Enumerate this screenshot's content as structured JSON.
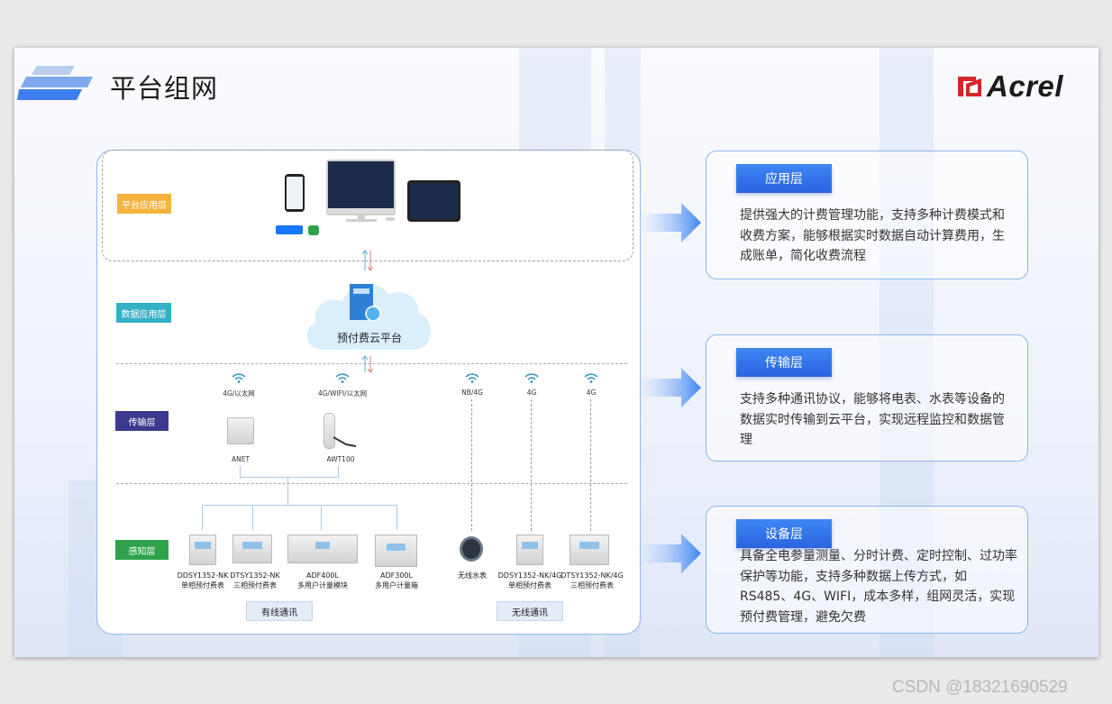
{
  "title": "平台组网",
  "brand": {
    "name": "Acrel",
    "color": "#d6262b"
  },
  "layers": {
    "platform": {
      "label": "平台应用层",
      "color": "#f3b33d"
    },
    "data": {
      "label": "数据应用层",
      "color": "#34b1c5"
    },
    "transport": {
      "label": "传输层",
      "color": "#3c3a8c"
    },
    "perception": {
      "label": "感知层",
      "color": "#2ea34c"
    }
  },
  "cloud_label": "预付费云平台",
  "network_labels": [
    "4G/以太网",
    "4G/WIFI/以太网",
    "NB/4G",
    "4G",
    "4G"
  ],
  "gateways": [
    "ANET",
    "AWT100"
  ],
  "wired_devices": [
    {
      "model": "DDSY1352-NK",
      "name": "单相预付费表"
    },
    {
      "model": "DTSY1352-NK",
      "name": "三相预付费表"
    },
    {
      "model": "ADF400L",
      "name": "多用户计量模块"
    },
    {
      "model": "ADF300L",
      "name": "多用户计量箱"
    }
  ],
  "wireless_devices": [
    {
      "model": "无线水表",
      "name": ""
    },
    {
      "model": "DDSY1352-NK/4G",
      "name": "单相预付费表"
    },
    {
      "model": "DTSY1352-NK/4G",
      "name": "三相预付费表"
    }
  ],
  "comm": {
    "wired": "有线通讯",
    "wireless": "无线通讯"
  },
  "cards": [
    {
      "title": "应用层",
      "text": "提供强大的计费管理功能，支持多种计费模式和收费方案，能够根据实时数据自动计算费用，生成账单，简化收费流程"
    },
    {
      "title": "传输层",
      "text": "支持多种通讯协议，能够将电表、水表等设备的数据实时传输到云平台，实现远程监控和数据管理"
    },
    {
      "title": "设备层",
      "text": "具备全电参量测量、分时计费、定时控制、过功率保护等功能，支持多种数据上传方式，如RS485、4G、WIFI，成本多样，组网灵活，实现预付费管理，避免欠费"
    }
  ],
  "payment_icons": [
    "alipay-icon",
    "wechat-icon"
  ],
  "watermark": "CSDN @18321690529"
}
